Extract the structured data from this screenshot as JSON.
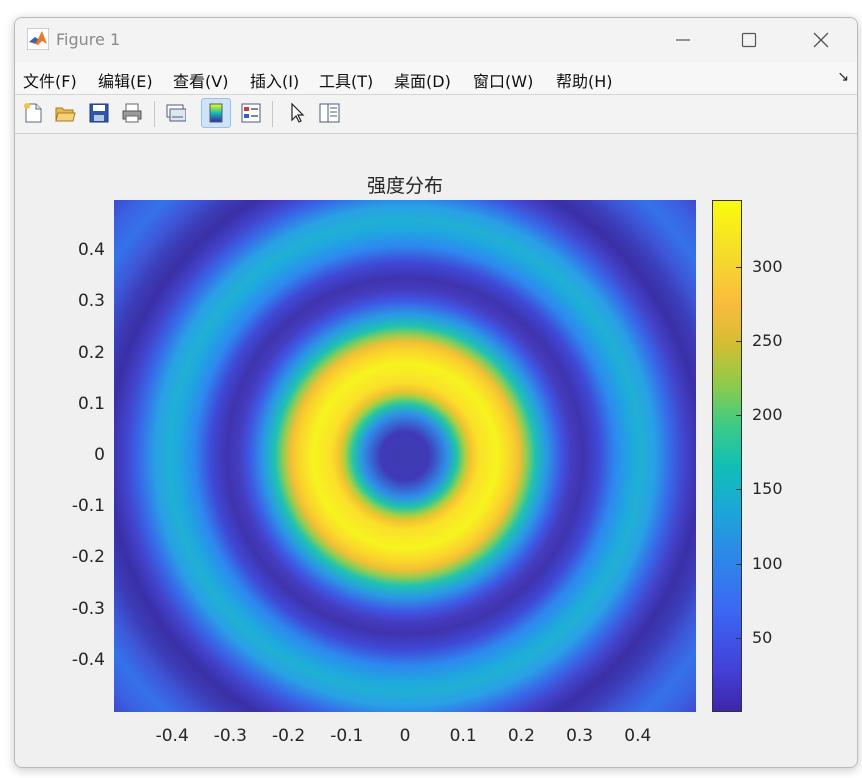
{
  "window": {
    "title": "Figure 1",
    "controls": [
      "minimize",
      "maximize",
      "close"
    ]
  },
  "menu": {
    "items": [
      "文件(F)",
      "编辑(E)",
      "查看(V)",
      "插入(I)",
      "工具(T)",
      "桌面(D)",
      "窗口(W)",
      "帮助(H)"
    ],
    "overflow_arrow": "↘"
  },
  "toolbar": {
    "buttons": [
      "new-figure-icon",
      "open-folder-icon",
      "save-icon",
      "print-icon",
      "link-plot-icon",
      "colorbar-toggle-icon",
      "legend-toggle-icon",
      "pointer-edit-icon",
      "property-inspector-icon"
    ],
    "active": "colorbar-toggle-icon"
  },
  "chart_data": {
    "type": "heatmap",
    "title": "强度分布",
    "xlabel": "",
    "ylabel": "",
    "xlim": [
      -0.5,
      0.5
    ],
    "ylim": [
      -0.5,
      0.5
    ],
    "x_ticks": [
      "-0.4",
      "-0.3",
      "-0.2",
      "-0.1",
      "0",
      "0.1",
      "0.2",
      "0.3",
      "0.4"
    ],
    "y_ticks": [
      "0.4",
      "0.3",
      "0.2",
      "0.1",
      "0",
      "-0.1",
      "-0.2",
      "-0.3",
      "-0.4"
    ],
    "colorbar": {
      "range": [
        0,
        345
      ],
      "ticks": [
        "300",
        "250",
        "200",
        "150",
        "100",
        "50"
      ],
      "colormap": "parula"
    },
    "pattern": "concentric rings",
    "ring_profile": [
      {
        "r": 0.0,
        "value": 10
      },
      {
        "r": 0.08,
        "value": 150
      },
      {
        "r": 0.15,
        "value": 340
      },
      {
        "r": 0.22,
        "value": 150
      },
      {
        "r": 0.28,
        "value": 20
      },
      {
        "r": 0.38,
        "value": 140
      },
      {
        "r": 0.47,
        "value": 15
      },
      {
        "r": 0.6,
        "value": 70
      }
    ]
  }
}
